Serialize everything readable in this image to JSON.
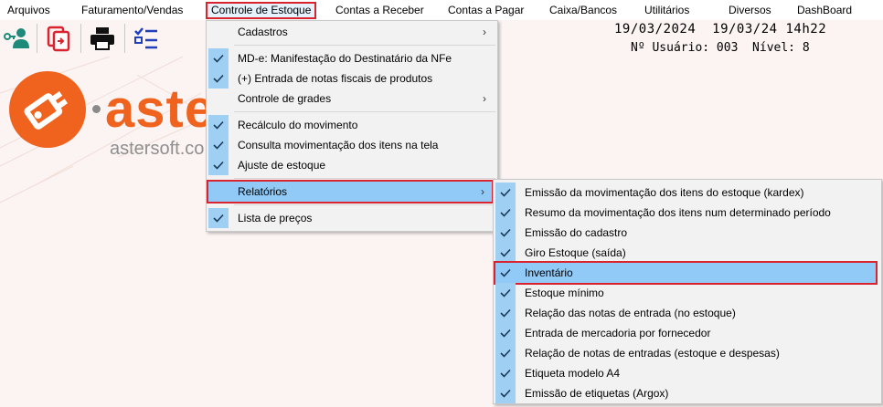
{
  "menubar": {
    "items": [
      {
        "label": "Arquivos"
      },
      {
        "label": "Faturamento/Vendas"
      },
      {
        "label": "Controle de Estoque"
      },
      {
        "label": "Contas a Receber"
      },
      {
        "label": "Contas a Pagar"
      },
      {
        "label": "Caixa/Bancos"
      },
      {
        "label": "Utilitários"
      },
      {
        "label": "Diversos"
      },
      {
        "label": "DashBoard"
      }
    ]
  },
  "toolbar": {
    "icons": [
      "user-key-icon",
      "document-transfer-icon",
      "printer-icon",
      "checklist-icon"
    ]
  },
  "brand": {
    "name": "aste",
    "url": "astersoft.co",
    "primary_color": "#f0631e"
  },
  "status": {
    "date_line": "19/03/2024  19/03/24 14h22",
    "user_line": "Nº Usuário: 003  Nível: 8"
  },
  "estoque_menu": {
    "items": [
      {
        "label": "Cadastros",
        "checked": false,
        "submenu": true
      },
      {
        "label": "MD-e: Manifestação do Destinatário da NFe",
        "checked": true
      },
      {
        "label": "(+) Entrada de notas fiscais de produtos",
        "checked": true
      },
      {
        "label": "Controle de grades",
        "checked": false,
        "submenu": true
      },
      {
        "label": "Recálculo do movimento",
        "checked": true
      },
      {
        "label": "Consulta movimentação dos itens na tela",
        "checked": true
      },
      {
        "label": "Ajuste de estoque",
        "checked": true
      },
      {
        "label": "Relatórios",
        "checked": false,
        "submenu": true,
        "highlighted": true
      },
      {
        "label": "Lista de preços",
        "checked": true
      }
    ]
  },
  "relatorios_menu": {
    "items": [
      {
        "label": "Emissão da movimentação dos itens do estoque (kardex)"
      },
      {
        "label": "Resumo da movimentação dos itens num determinado período"
      },
      {
        "label": "Emissão do cadastro"
      },
      {
        "label": "Giro Estoque (saída)"
      },
      {
        "label": "Inventário",
        "highlighted": true
      },
      {
        "label": "Estoque mínimo"
      },
      {
        "label": "Relação das notas de entrada (no estoque)"
      },
      {
        "label": "Entrada de mercadoria por fornecedor"
      },
      {
        "label": "Relação de notas de entradas (estoque e despesas)"
      },
      {
        "label": "Etiqueta modelo A4"
      },
      {
        "label": "Emissão de etiquetas (Argox)"
      }
    ]
  },
  "colors": {
    "highlight_border": "#d9232e",
    "highlight_fill": "#91c9f7",
    "check_fill": "#9fd0f3"
  }
}
